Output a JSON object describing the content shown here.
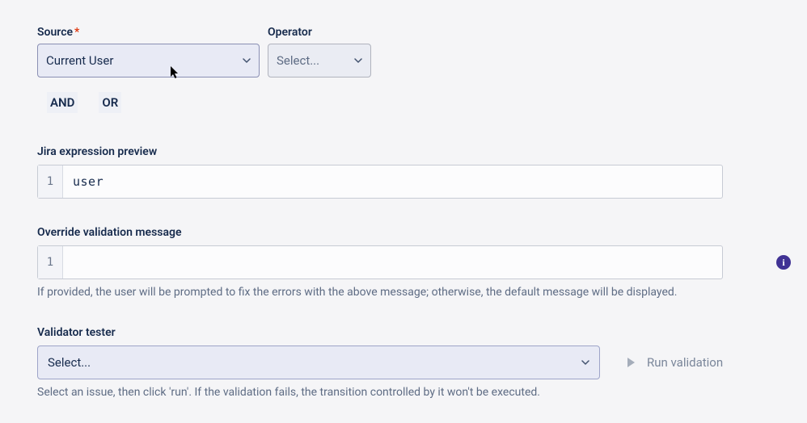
{
  "row1": {
    "source_label": "Source",
    "source_value": "Current User",
    "operator_label": "Operator",
    "operator_placeholder": "Select..."
  },
  "logic": {
    "and": "AND",
    "or": "OR"
  },
  "preview": {
    "label": "Jira expression preview",
    "line_no": "1",
    "code": "user"
  },
  "override": {
    "label": "Override validation message",
    "line_no": "1",
    "value": "",
    "helper": "If provided, the user will be prompted to fix the errors with the above message; otherwise, the default message will be displayed."
  },
  "tester": {
    "label": "Validator tester",
    "placeholder": "Select...",
    "run_label": "Run validation",
    "helper": "Select an issue, then click 'run'. If the validation fails, the transition controlled by it won't be executed."
  },
  "info_badge": "i"
}
